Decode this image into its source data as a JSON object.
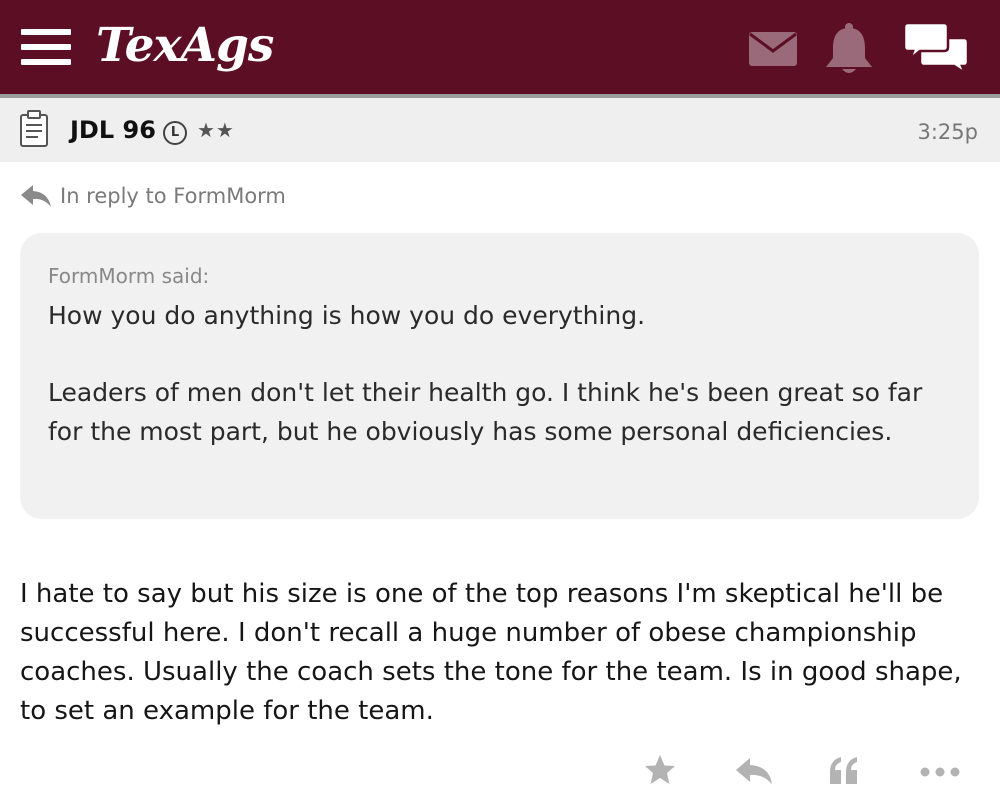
{
  "header": {
    "logo_text": "TexAgs",
    "bg_color": "#5c0f24",
    "icons": [
      "menu-icon",
      "mail-icon",
      "bell-icon",
      "chat-icon"
    ]
  },
  "post": {
    "username": "JDL 96",
    "badge": "L",
    "stars": "★★",
    "time": "3:25p",
    "reply_to": "In reply to FormMorm",
    "quote": {
      "author": "FormMorm said:",
      "paragraph1": "How you do anything is how you do everything.",
      "paragraph2": "Leaders of men don't let their health go. I think he's been great so far for the most part, but he obviously has some personal deficiencies."
    },
    "body": "I hate to say but his size is one of the top reasons I'm skeptical he'll be successful here. I don't recall a huge number of obese championship coaches. Usually the coach sets the tone for the team. Is in good shape, to set an example for the team.",
    "actions": [
      "star-icon",
      "reply-icon",
      "quote-icon",
      "more-icon"
    ]
  }
}
